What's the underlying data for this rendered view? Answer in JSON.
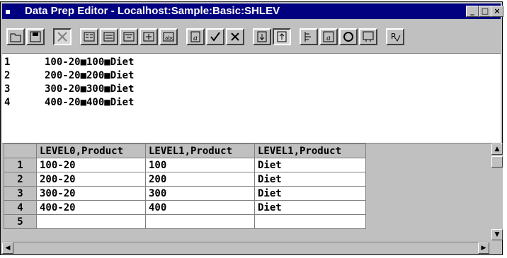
{
  "window": {
    "title": "Data Prep Editor - Localhost:Sample:Basic:SHLEV"
  },
  "textview": {
    "lines": [
      {
        "num": "1",
        "text": "100-20■100■Diet"
      },
      {
        "num": "2",
        "text": "200-20■200■Diet"
      },
      {
        "num": "3",
        "text": "300-20■300■Diet"
      },
      {
        "num": "4",
        "text": "400-20■400■Diet"
      }
    ]
  },
  "grid": {
    "headers": [
      "LEVEL0,Product",
      "LEVEL1,Product",
      "LEVEL1,Product"
    ],
    "rows": [
      {
        "num": "1",
        "cells": [
          "100-20",
          "100",
          "Diet"
        ]
      },
      {
        "num": "2",
        "cells": [
          "200-20",
          "200",
          "Diet"
        ]
      },
      {
        "num": "3",
        "cells": [
          "300-20",
          "300",
          "Diet"
        ]
      },
      {
        "num": "4",
        "cells": [
          "400-20",
          "400",
          "Diet"
        ]
      },
      {
        "num": "5",
        "cells": [
          "",
          "",
          ""
        ]
      }
    ]
  },
  "toolbar": {
    "buttons": [
      "open-icon",
      "save-icon",
      "sort-icon",
      "field-props-icon",
      "data-file-props-icon",
      "dimension-build-icon",
      "join-icon",
      "create-field-text-icon",
      "create-field-join-icon",
      "split-icon",
      "select-record-icon",
      "reject-record-icon",
      "move-icon",
      "ignore-field-icon",
      "associate-outline-icon",
      "dim-build-settings-icon",
      "view-data-icon",
      "view-field-icon",
      "validate-icon"
    ]
  }
}
